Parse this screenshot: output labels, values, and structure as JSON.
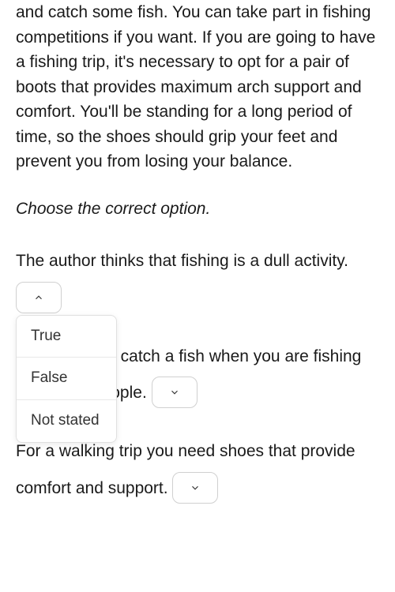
{
  "passage": "and catch some fish. You can take part in fishing competitions if you want. If you are going to have a fishing trip, it's necessary to opt for a pair of boots that provides maximum arch support and comfort. You'll be standing for a long period of time, so the shoes should grip your feet and prevent you from losing your balance.",
  "instruction": "Choose the correct option.",
  "questions": [
    {
      "text_before": "The author thinks that fishing is a dull activity.",
      "text_after": "",
      "expanded": true
    },
    {
      "text_before": "It is difficult to catch a fish when you are fishing with other people.",
      "text_after": "",
      "expanded": false
    },
    {
      "text_before": "For a walking trip you need shoes that provide comfort and support.",
      "text_after": "",
      "expanded": false
    }
  ],
  "dropdown_options": [
    "True",
    "False",
    "Not stated"
  ]
}
